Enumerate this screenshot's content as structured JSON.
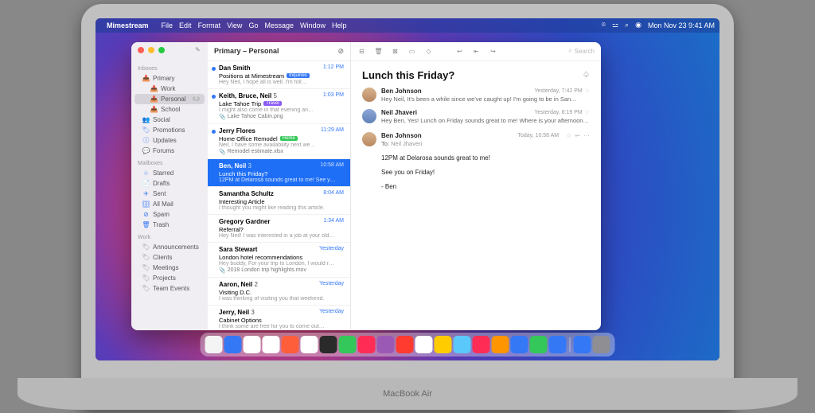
{
  "menubar": {
    "app": "Mimestream",
    "items": [
      "File",
      "Edit",
      "Format",
      "View",
      "Go",
      "Message",
      "Window",
      "Help"
    ],
    "datetime": "Mon Nov 23  9:41 AM"
  },
  "sidebar": {
    "sections": [
      {
        "title": "Inboxes",
        "items": [
          {
            "icon": "inbox",
            "label": "Primary",
            "color": "blue"
          },
          {
            "icon": "inbox",
            "label": "Work",
            "color": "gray",
            "sub": true
          },
          {
            "icon": "inbox",
            "label": "Personal",
            "color": "blue",
            "sub": true,
            "badge": "3",
            "selected": true
          },
          {
            "icon": "inbox",
            "label": "School",
            "color": "gray",
            "sub": true
          },
          {
            "icon": "people",
            "label": "Social",
            "color": "blue"
          },
          {
            "icon": "tag",
            "label": "Promotions",
            "color": "blue"
          },
          {
            "icon": "info",
            "label": "Updates",
            "color": "blue"
          },
          {
            "icon": "chat",
            "label": "Forums",
            "color": "blue"
          }
        ]
      },
      {
        "title": "Mailboxes",
        "items": [
          {
            "icon": "star",
            "label": "Starred"
          },
          {
            "icon": "doc",
            "label": "Drafts"
          },
          {
            "icon": "send",
            "label": "Sent"
          },
          {
            "icon": "archive",
            "label": "All Mail"
          },
          {
            "icon": "spam",
            "label": "Spam"
          },
          {
            "icon": "trash",
            "label": "Trash"
          }
        ]
      },
      {
        "title": "Work",
        "items": [
          {
            "icon": "tag",
            "label": "Announcements",
            "color": "gray"
          },
          {
            "icon": "tag",
            "label": "Clients",
            "color": "gray"
          },
          {
            "icon": "tag",
            "label": "Meetings",
            "color": "gray"
          },
          {
            "icon": "tag",
            "label": "Projects",
            "color": "gray"
          },
          {
            "icon": "tag",
            "label": "Team Events",
            "color": "gray"
          }
        ]
      }
    ]
  },
  "list": {
    "title": "Primary – Personal",
    "messages": [
      {
        "from": "Dan Smith",
        "time": "1:12 PM",
        "unread": true,
        "subject": "Positions at Mimestream",
        "preview": "Hey Neil, I hope all is well. I'm foll…",
        "tag": {
          "text": "Inquiries",
          "cls": "inq"
        }
      },
      {
        "from": "Keith, Bruce, Neil",
        "count": "5",
        "time": "1:03 PM",
        "unread": true,
        "subject": "Lake Tahoe Trip",
        "preview": "I might also come in that evening an…",
        "tag": {
          "text": "Travel",
          "cls": "trv"
        },
        "attachment": "Lake Tahoe Cabin.png"
      },
      {
        "from": "Jerry Flores",
        "time": "11:29 AM",
        "unread": true,
        "subject": "Home Office Remodel",
        "preview": "Neil, I have some availability next we…",
        "tag": {
          "text": "Home",
          "cls": "hom"
        },
        "attachment": "Remodel estimate.xlsx"
      },
      {
        "from": "Ben, Neil",
        "count": "3",
        "time": "10:58 AM",
        "selected": true,
        "subject": "Lunch this Friday?",
        "preview": "12PM at Delarosa sounds great to me! See y…"
      },
      {
        "from": "Samantha Schultz",
        "time": "8:04 AM",
        "subject": "Interesting Article",
        "preview": "I thought you might like reading this article."
      },
      {
        "from": "Gregory Gardner",
        "time": "1:34 AM",
        "subject": "Referral?",
        "preview": "Hey Neil! I was interested in a job at your old…"
      },
      {
        "from": "Sara Stewart",
        "time": "Yesterday",
        "subject": "London hotel recommendations",
        "preview": "Hey buddy, For your trip to London, I would r…",
        "attachment": "2018 London trip highlights.mov"
      },
      {
        "from": "Aaron, Neil",
        "count": "2",
        "time": "Yesterday",
        "subject": "Visiting D.C.",
        "preview": "I was thinking of visiting you that weekend."
      },
      {
        "from": "Jerry, Neil",
        "count": "3",
        "time": "Yesterday",
        "subject": "Cabinet Options",
        "preview": "I think some are free for you to come out…"
      }
    ]
  },
  "reader": {
    "search_placeholder": "Search",
    "title": "Lunch this Friday?",
    "thread": [
      {
        "avatar": "bj",
        "from": "Ben Johnson",
        "when": "Yesterday, 7:42 PM",
        "preview": "Hey Neil, It's been a while since we've caught up! I'm going to be in San…"
      },
      {
        "avatar": "nj",
        "from": "Neil Jhaveri",
        "when": "Yesterday, 8:19 PM",
        "preview": "Hey Ben, Yes! Lunch on Friday sounds great to me! Where is your afternoon…"
      }
    ],
    "expanded": {
      "avatar": "bj",
      "from": "Ben Johnson",
      "when": "Today, 10:58 AM",
      "to_label": "To:",
      "to": "Neil Jhaveri",
      "body": [
        "12PM at Delarosa sounds great to me!",
        "See you on Friday!",
        "- Ben"
      ]
    }
  },
  "laptop_model": "MacBook Air",
  "dock_colors": [
    "#f4f4f4",
    "#3478f6",
    "#fff",
    "#fff",
    "#ff5e3a",
    "#fff",
    "#2a2a2a",
    "#34c759",
    "#ff2d55",
    "#9b59b6",
    "#ff3b30",
    "#fff",
    "#ffcc00",
    "#5ac8fa",
    "#ff2d55",
    "#ff9500",
    "#3478f6",
    "#34c759",
    "#3478f6",
    "#3478f6",
    "#8e8e93"
  ]
}
